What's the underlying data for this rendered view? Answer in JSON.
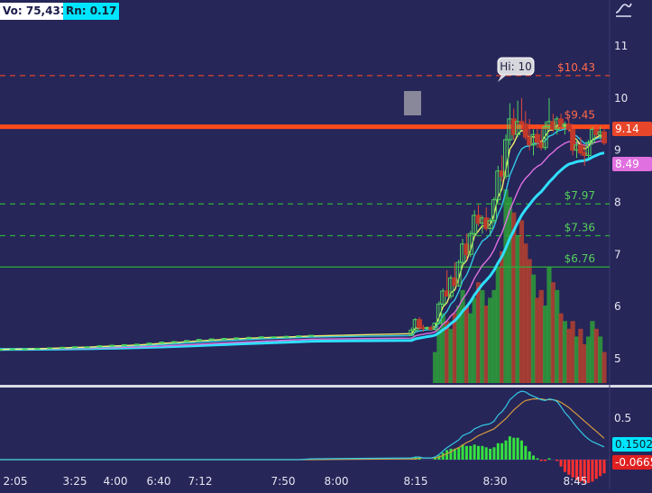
{
  "header": {
    "volume_label": "Vo: 75,431",
    "range_label": "Rn: 0.17"
  },
  "colors": {
    "background": "#262659",
    "up_candle": "#2e9e3a",
    "down_candle": "#c0392b",
    "resistance_line": "#ff4a1c",
    "target_line": "#e0442a",
    "support_line": "#2fae3a",
    "ema_fast": "#f0f06a",
    "ema_mid": "#33c9e6",
    "ema_slow": "#e070e0",
    "vwap": "#2fe0ff",
    "price_badge": "#e8462a",
    "ema_badge": "#e070e0",
    "macd_badge": "#00e5ff",
    "hist_badge": "#e02020"
  },
  "icon": "trend-line-icon",
  "chart_data": {
    "type": "candlestick",
    "price_axis": {
      "min": 4.5,
      "max": 11.5,
      "ticks": [
        "5",
        "6",
        "7",
        "8",
        "9",
        "10",
        "11"
      ]
    },
    "time_labels": [
      "2:05",
      "3:25",
      "4:00",
      "6:40",
      "7:12",
      "7:50",
      "8:00",
      "8:15",
      "8:30",
      "8:45"
    ],
    "hi_label": "Hi: 10",
    "resistance": {
      "value": 9.45,
      "label": "$9.45"
    },
    "levels": [
      {
        "value": 10.43,
        "label": "$10.43",
        "kind": "target"
      },
      {
        "value": 7.97,
        "label": "$7.97",
        "kind": "support"
      },
      {
        "value": 7.36,
        "label": "$7.36",
        "kind": "support"
      },
      {
        "value": 6.76,
        "label": "$6.76",
        "kind": "support"
      }
    ],
    "badges": {
      "last_price": "9.14",
      "ema_value": "8.49",
      "macd_value": "0.1502",
      "hist_value": "-0.0665"
    },
    "lower_axis_tick": "0.5",
    "candles": [
      [
        5.18,
        5.19,
        5.17,
        5.18
      ],
      [
        5.18,
        5.2,
        5.17,
        5.19
      ],
      [
        5.19,
        5.2,
        5.18,
        5.19
      ],
      [
        5.19,
        5.21,
        5.18,
        5.2
      ],
      [
        5.2,
        5.22,
        5.19,
        5.21
      ],
      [
        5.21,
        5.23,
        5.2,
        5.22
      ],
      [
        5.22,
        5.24,
        5.21,
        5.23
      ],
      [
        5.23,
        5.24,
        5.22,
        5.23
      ],
      [
        5.23,
        5.26,
        5.22,
        5.25
      ],
      [
        5.25,
        5.27,
        5.24,
        5.26
      ],
      [
        5.26,
        5.28,
        5.25,
        5.27
      ],
      [
        5.27,
        5.29,
        5.26,
        5.28
      ],
      [
        5.28,
        5.31,
        5.27,
        5.3
      ],
      [
        5.3,
        5.33,
        5.29,
        5.32
      ],
      [
        5.32,
        5.34,
        5.31,
        5.33
      ],
      [
        5.33,
        5.36,
        5.32,
        5.35
      ],
      [
        5.35,
        5.38,
        5.34,
        5.37
      ],
      [
        5.37,
        5.39,
        5.36,
        5.38
      ],
      [
        5.38,
        5.4,
        5.37,
        5.39
      ],
      [
        5.39,
        5.41,
        5.38,
        5.4
      ],
      [
        5.4,
        5.42,
        5.39,
        5.41
      ],
      [
        5.41,
        5.43,
        5.4,
        5.42
      ],
      [
        5.42,
        5.43,
        5.41,
        5.42
      ],
      [
        5.42,
        5.44,
        5.41,
        5.43
      ],
      [
        5.43,
        5.45,
        5.42,
        5.44
      ],
      [
        5.44,
        5.46,
        5.43,
        5.45
      ],
      [
        5.45,
        5.6,
        5.44,
        5.55
      ],
      [
        5.55,
        5.78,
        5.5,
        5.75
      ],
      [
        5.75,
        5.8,
        5.55,
        5.6
      ],
      [
        5.6,
        5.65,
        5.52,
        5.58
      ],
      [
        5.58,
        5.62,
        5.55,
        5.6
      ],
      [
        5.6,
        5.63,
        5.55,
        5.56
      ],
      [
        5.56,
        5.7,
        5.55,
        5.68
      ],
      [
        5.68,
        6.1,
        5.66,
        6.05
      ],
      [
        6.05,
        6.35,
        6.0,
        6.3
      ],
      [
        6.3,
        6.7,
        6.25,
        6.2
      ],
      [
        6.2,
        6.6,
        6.15,
        6.55
      ],
      [
        6.55,
        6.85,
        6.5,
        6.4
      ],
      [
        6.4,
        6.9,
        6.38,
        6.85
      ],
      [
        6.85,
        7.3,
        6.8,
        7.2
      ],
      [
        7.2,
        7.4,
        6.9,
        7.0
      ],
      [
        7.0,
        7.45,
        6.95,
        7.4
      ],
      [
        7.4,
        7.85,
        7.35,
        7.75
      ],
      [
        7.75,
        7.95,
        7.55,
        7.6
      ],
      [
        7.6,
        7.75,
        7.4,
        7.7
      ],
      [
        7.7,
        7.9,
        7.45,
        7.5
      ],
      [
        7.5,
        7.7,
        7.4,
        7.65
      ],
      [
        7.65,
        8.1,
        7.6,
        8.05
      ],
      [
        8.05,
        8.7,
        8.0,
        8.6
      ],
      [
        8.6,
        8.9,
        8.4,
        8.5
      ],
      [
        8.5,
        9.3,
        8.45,
        9.2
      ],
      [
        9.2,
        9.9,
        9.1,
        9.6
      ],
      [
        9.6,
        9.8,
        9.2,
        9.3
      ],
      [
        9.3,
        9.95,
        9.25,
        9.55
      ],
      [
        9.55,
        10.0,
        9.4,
        9.5
      ],
      [
        9.5,
        9.75,
        9.2,
        9.25
      ],
      [
        9.25,
        9.6,
        9.0,
        9.1
      ],
      [
        9.1,
        9.4,
        8.9,
        9.3
      ],
      [
        9.3,
        9.5,
        9.05,
        9.15
      ],
      [
        9.15,
        9.4,
        9.0,
        9.05
      ],
      [
        9.05,
        9.55,
        9.0,
        9.45
      ],
      [
        9.45,
        10.0,
        9.4,
        9.55
      ],
      [
        9.55,
        9.7,
        9.35,
        9.4
      ],
      [
        9.4,
        9.65,
        9.3,
        9.6
      ],
      [
        9.6,
        9.7,
        9.4,
        9.45
      ],
      [
        9.45,
        9.55,
        9.3,
        9.5
      ],
      [
        9.5,
        9.6,
        9.35,
        9.4
      ],
      [
        9.4,
        9.5,
        8.9,
        9.0
      ],
      [
        9.0,
        9.2,
        8.85,
        9.1
      ],
      [
        9.1,
        9.25,
        8.9,
        8.95
      ],
      [
        8.95,
        9.1,
        8.7,
        8.9
      ],
      [
        8.9,
        9.2,
        8.85,
        9.15
      ],
      [
        9.15,
        9.45,
        9.1,
        9.4
      ],
      [
        9.4,
        9.5,
        9.25,
        9.3
      ],
      [
        9.3,
        9.45,
        9.2,
        9.35
      ],
      [
        9.35,
        9.4,
        9.1,
        9.14
      ]
    ],
    "volume": [
      0,
      0,
      0,
      0,
      0,
      0,
      0,
      0,
      0,
      0,
      0,
      0,
      0,
      0,
      0,
      0,
      0,
      0,
      0,
      0,
      0,
      0,
      0,
      0,
      0,
      0,
      0,
      0,
      0,
      0,
      0,
      0,
      4,
      7,
      9,
      8,
      7,
      9,
      10,
      12,
      10,
      9,
      11,
      13,
      12,
      10,
      11,
      12,
      15,
      17,
      25,
      24,
      22,
      19,
      21,
      18,
      16,
      14,
      11,
      12,
      10,
      15,
      13,
      12,
      9,
      8,
      7,
      8,
      6,
      7,
      5,
      6,
      8,
      7,
      6,
      4
    ],
    "macd": [
      0,
      0,
      0,
      0,
      0,
      0,
      0,
      0,
      0,
      0,
      0,
      0,
      0,
      0,
      0,
      0,
      0,
      0,
      0,
      0,
      0,
      0,
      0,
      0,
      0,
      0.01,
      0.02,
      0.03,
      0.03,
      0.02,
      0.02,
      0.02,
      0.03,
      0.06,
      0.1,
      0.14,
      0.17,
      0.2,
      0.23,
      0.28,
      0.3,
      0.32,
      0.36,
      0.38,
      0.4,
      0.41,
      0.42,
      0.45,
      0.52,
      0.56,
      0.62,
      0.7,
      0.74,
      0.78,
      0.8,
      0.79,
      0.76,
      0.74,
      0.72,
      0.7,
      0.69,
      0.71,
      0.7,
      0.68,
      0.62,
      0.55,
      0.5,
      0.44,
      0.38,
      0.33,
      0.28,
      0.24,
      0.21,
      0.19,
      0.17,
      0.15
    ],
    "macd_signal": [
      0,
      0,
      0,
      0,
      0,
      0,
      0,
      0,
      0,
      0,
      0,
      0,
      0,
      0,
      0,
      0,
      0,
      0,
      0,
      0,
      0,
      0,
      0,
      0,
      0,
      0,
      0.01,
      0.01,
      0.02,
      0.02,
      0.02,
      0.02,
      0.02,
      0.03,
      0.05,
      0.07,
      0.09,
      0.12,
      0.14,
      0.17,
      0.2,
      0.22,
      0.25,
      0.28,
      0.3,
      0.32,
      0.34,
      0.36,
      0.4,
      0.44,
      0.48,
      0.53,
      0.58,
      0.62,
      0.66,
      0.69,
      0.7,
      0.71,
      0.71,
      0.71,
      0.7,
      0.7,
      0.7,
      0.69,
      0.67,
      0.64,
      0.61,
      0.57,
      0.53,
      0.49,
      0.45,
      0.41,
      0.37,
      0.33,
      0.29,
      0.25
    ]
  }
}
